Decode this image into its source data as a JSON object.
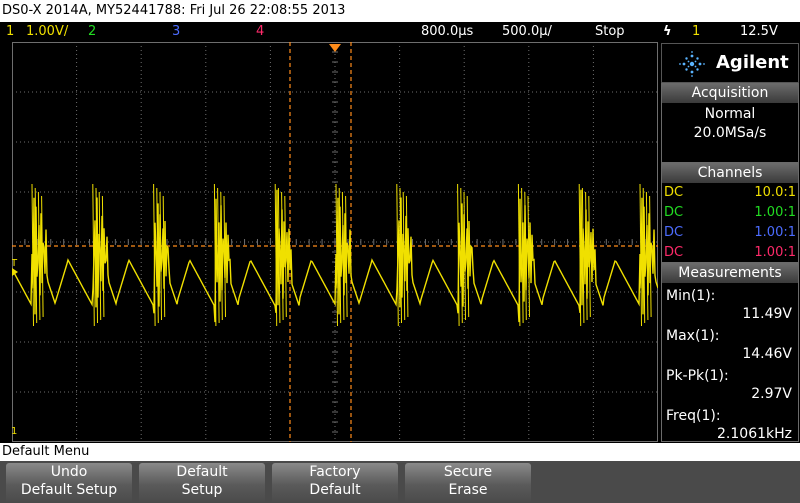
{
  "title": "DS0-X 2014A, MY52441788: Fri Jul 26 22:08:55 2013",
  "status": {
    "ch1_num": "1",
    "ch1_scale": "1.00V/",
    "ch2_num": "2",
    "ch3_num": "3",
    "ch4_num": "4",
    "time_delay": "800.0&#x1d4c8;",
    "time_delay_text": "800.0µs",
    "time_scale_text": "500.0µ/",
    "run_state": "Stop",
    "trigger_glyph": "ϟ",
    "trigger_source": "1",
    "trigger_level": "12.5V"
  },
  "brand": "Agilent",
  "acquisition": {
    "header": "Acquisition",
    "mode": "Normal",
    "rate": "20.0MSa/s"
  },
  "channels": {
    "header": "Channels",
    "rows": [
      {
        "coupling": "DC",
        "probe": "10.0:1",
        "color": "#f0e000"
      },
      {
        "coupling": "DC",
        "probe": "1.00:1",
        "color": "#22dd22"
      },
      {
        "coupling": "DC",
        "probe": "1.00:1",
        "color": "#4c6cff"
      },
      {
        "coupling": "DC",
        "probe": "1.00:1",
        "color": "#ff2a6a"
      }
    ]
  },
  "measurements": {
    "header": "Measurements",
    "items": [
      {
        "label": "Min(1):",
        "value": "11.49V"
      },
      {
        "label": "Max(1):",
        "value": "14.46V"
      },
      {
        "label": "Pk-Pk(1):",
        "value": "2.97V"
      },
      {
        "label": "Freq(1):",
        "value": "2.1061kHz"
      }
    ]
  },
  "menu": {
    "title": "Default Menu",
    "keys": [
      {
        "line1": "Undo",
        "line2": "Default Setup"
      },
      {
        "line1": "Default",
        "line2": "Setup"
      },
      {
        "line1": "Factory",
        "line2": "Default"
      },
      {
        "line1": "Secure",
        "line2": "Erase"
      }
    ]
  },
  "markers": {
    "trigger_level_marker": "T",
    "ground_marker": "1"
  },
  "colors": {
    "ch1": "#f0e000",
    "ch2": "#22dd22",
    "ch3": "#4c6cff",
    "ch4": "#ff2a6a",
    "cursor": "#ff8c1a",
    "grid": "#6e6e6e"
  }
}
